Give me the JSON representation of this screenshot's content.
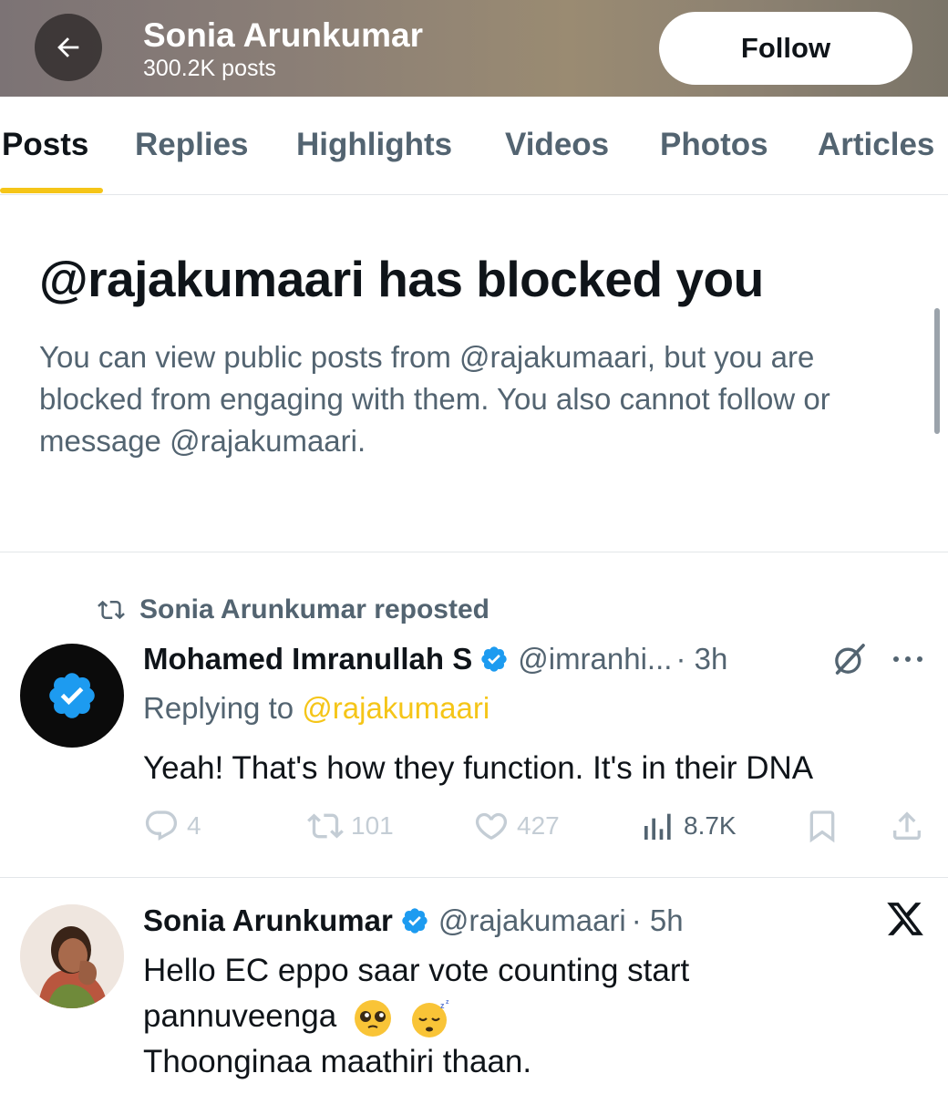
{
  "header": {
    "title": "Sonia Arunkumar",
    "subtitle": "300.2K posts",
    "follow_label": "Follow"
  },
  "tabs": [
    {
      "label": "Posts",
      "active": true
    },
    {
      "label": "Replies"
    },
    {
      "label": "Highlights"
    },
    {
      "label": "Videos"
    },
    {
      "label": "Photos"
    },
    {
      "label": "Articles"
    }
  ],
  "blocked": {
    "title": "@rajakumaari has blocked you",
    "description": "You can view public posts from @rajakumaari, but you are blocked from engaging with them. You also cannot follow or message @rajakumaari."
  },
  "posts": [
    {
      "repost_label": "Sonia Arunkumar reposted",
      "author": "Mohamed Imranullah S",
      "handle": "@imranhi...",
      "time": "· 3h",
      "replying_prefix": "Replying to",
      "replying_to": "@rajakumaari",
      "text": "Yeah! That's how they function. It's in their DNA",
      "stats": {
        "replies": "4",
        "reposts": "101",
        "likes": "427",
        "views": "8.7K"
      }
    },
    {
      "author": "Sonia Arunkumar",
      "handle": "@rajakumaari",
      "time": "· 5h",
      "text_line1": "Hello EC eppo saar vote counting start",
      "text_line2": "pannuveenga",
      "text_line3": "Thoonginaa maathiri thaan."
    }
  ],
  "colors": {
    "accent": "#f5c518",
    "verified": "#1d9bf0",
    "secondary_text": "#536471"
  }
}
